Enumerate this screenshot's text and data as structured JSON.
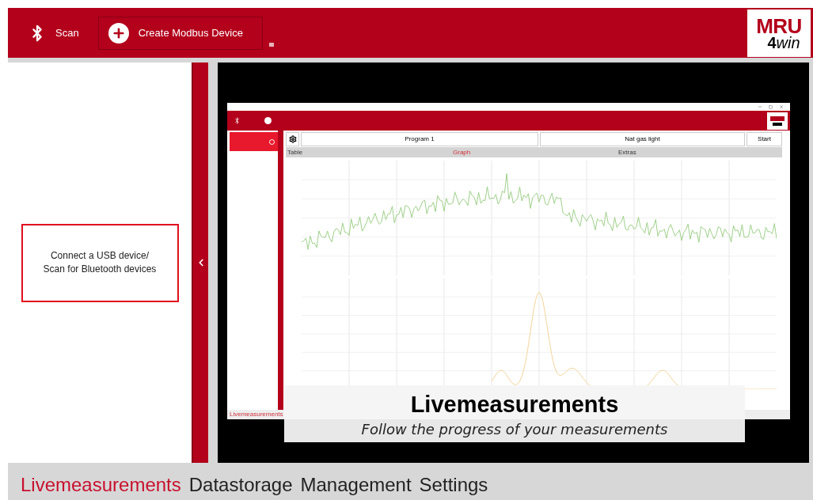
{
  "toolbar": {
    "scan": "Scan",
    "create": "Create Modbus Device",
    "logo": {
      "top": "MRU",
      "digit": "4",
      "word": "win"
    }
  },
  "left_panel": {
    "message_lines": [
      "Connect a USB device/",
      "Scan for Bluetooth devices"
    ]
  },
  "slide": {
    "app": {
      "controls": {
        "program": "Program 1",
        "fuel": "Nat gas light",
        "start": "Start"
      },
      "tabs": [
        {
          "label": "Table",
          "selected": false
        },
        {
          "label": "Graph",
          "selected": true
        },
        {
          "label": "Extras",
          "selected": false
        }
      ],
      "nav_item": "Livemeasurements"
    },
    "caption": {
      "title": "Livemeasurements",
      "subtitle": "Follow the progress of your measurements"
    }
  },
  "nav": [
    {
      "label": "Livemeasurements",
      "selected": true
    },
    {
      "label": "Datastorage",
      "selected": false
    },
    {
      "label": "Management",
      "selected": false
    },
    {
      "label": "Settings",
      "selected": false
    }
  ]
}
